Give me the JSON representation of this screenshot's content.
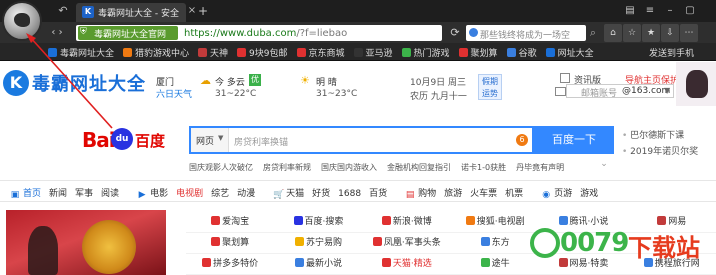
{
  "browser": {
    "tab_title": "毒霸网址大全 - 安全",
    "secure_label": "毒霸网址大全官网",
    "url_main": "https://www.duba.com",
    "url_query": "/?f=liebao",
    "search_placeholder": "那些钱终将成为一场空",
    "bookmarks": [
      {
        "label": "毒霸网址大全",
        "color": "#1a6fd8"
      },
      {
        "label": "猎豹游戏中心",
        "color": "#f07a12"
      },
      {
        "label": "天神",
        "color": "#c23b3b"
      },
      {
        "label": "9块9包邮",
        "color": "#e03131"
      },
      {
        "label": "京东商城",
        "color": "#e03131"
      },
      {
        "label": "亚马逊",
        "color": "#333333"
      },
      {
        "label": "热门游戏",
        "color": "#3cb44a"
      },
      {
        "label": "聚划算",
        "color": "#e03131"
      },
      {
        "label": "谷歌",
        "color": "#3a7fe0"
      },
      {
        "label": "网址大全",
        "color": "#1a6fd8"
      }
    ],
    "bookmark_partial": "热门小游戏",
    "send_phone": "发送到手机"
  },
  "header": {
    "logo_letter": "K",
    "site_name": "毒霸网址大全",
    "weather_city": "厦门",
    "weather_link": "六日天气",
    "today_desc": "今  多云",
    "aqi": "优",
    "today_temp": "31~22°C",
    "tomorrow_desc": "明  晴",
    "tomorrow_temp": "31~23°C",
    "date": "10月9日  周三",
    "lunar": "农历 九月十一",
    "holiday": "假期\n运势",
    "news_link": "资讯版",
    "nav_home": "导航主页保护",
    "mail_placeholder": "邮箱账号",
    "mail_domain": "@163.com"
  },
  "search": {
    "logo_text": "Bai",
    "logo_paw": "du",
    "logo_cn": "百度",
    "type": "网页",
    "query": "房贷利率换锚",
    "hot_num": "6",
    "button": "百度一下",
    "hot_list": [
      "巴尔德斯下课",
      "2019年诺贝尔奖"
    ],
    "suggestions": [
      "国庆观影人次破亿",
      "房贷利率新规",
      "国庆国内游收入",
      "金融机构回复指引",
      "诺卡1-0获胜",
      "丹毕竟有声明"
    ]
  },
  "categories": [
    {
      "label": "首页",
      "style": "blue"
    },
    {
      "label": "新闻",
      "style": ""
    },
    {
      "label": "军事",
      "style": ""
    },
    {
      "label": "阅读",
      "style": ""
    },
    {
      "label": "电影",
      "style": ""
    },
    {
      "label": "电视剧",
      "style": "red"
    },
    {
      "label": "综艺",
      "style": ""
    },
    {
      "label": "动漫",
      "style": ""
    },
    {
      "label": "天猫",
      "style": ""
    },
    {
      "label": "好货",
      "style": ""
    },
    {
      "label": "1688",
      "style": ""
    },
    {
      "label": "百货",
      "style": ""
    },
    {
      "label": "购物",
      "style": ""
    },
    {
      "label": "旅游",
      "style": ""
    },
    {
      "label": "火车票",
      "style": ""
    },
    {
      "label": "机票",
      "style": ""
    },
    {
      "label": "页游",
      "style": ""
    },
    {
      "label": "游戏",
      "style": ""
    }
  ],
  "sites": [
    [
      {
        "label": "爱淘宝",
        "color": "#e03131",
        "style": ""
      },
      {
        "label": "百度·搜索",
        "color": "#2932e1",
        "style": ""
      },
      {
        "label": "新浪·微博",
        "color": "#e03131",
        "style": ""
      },
      {
        "label": "搜狐·电视剧",
        "color": "#f07a12",
        "style": ""
      },
      {
        "label": "腾讯·小说",
        "color": "#3a7fe0",
        "style": ""
      },
      {
        "label": "网易",
        "color": "#c23b3b",
        "style": ""
      }
    ],
    [
      {
        "label": "聚划算",
        "color": "#e03131",
        "style": ""
      },
      {
        "label": "苏宁易购",
        "color": "#f0b000",
        "style": ""
      },
      {
        "label": "凤凰·军事头条",
        "color": "#e03131",
        "style": ""
      },
      {
        "label": "东方",
        "color": "#3a7fe0",
        "style": ""
      },
      {
        "label": "",
        "color": "",
        "style": ""
      },
      {
        "label": "",
        "color": "",
        "style": ""
      }
    ],
    [
      {
        "label": "拼多多特价",
        "color": "#e03131",
        "style": ""
      },
      {
        "label": "最新小说",
        "color": "#3a7fe0",
        "style": ""
      },
      {
        "label": "天猫·精选",
        "color": "#e03131",
        "style": "red"
      },
      {
        "label": "途牛",
        "color": "#3cb44a",
        "style": ""
      },
      {
        "label": "网易·特卖",
        "color": "#c23b3b",
        "style": ""
      },
      {
        "label": "携程旅行网",
        "color": "#3a7fe0",
        "style": ""
      }
    ]
  ],
  "watermark": {
    "text": "0079",
    "text2": "下载站"
  }
}
